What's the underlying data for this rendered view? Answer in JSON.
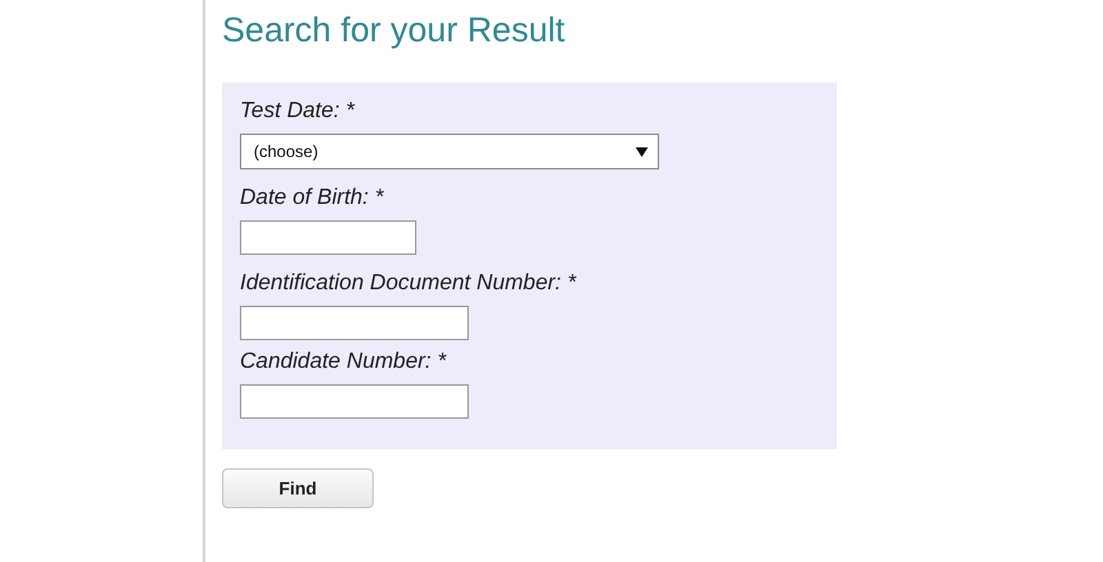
{
  "title": "Search for your Result",
  "fields": [
    {
      "kind": "select",
      "label": "Test Date: *",
      "value": "(choose)"
    },
    {
      "kind": "date",
      "label": "Date of Birth: *"
    },
    {
      "kind": "text",
      "label": "Identification Document Number: *"
    },
    {
      "kind": "text",
      "label": "Candidate Number: *"
    }
  ],
  "button": "Find"
}
